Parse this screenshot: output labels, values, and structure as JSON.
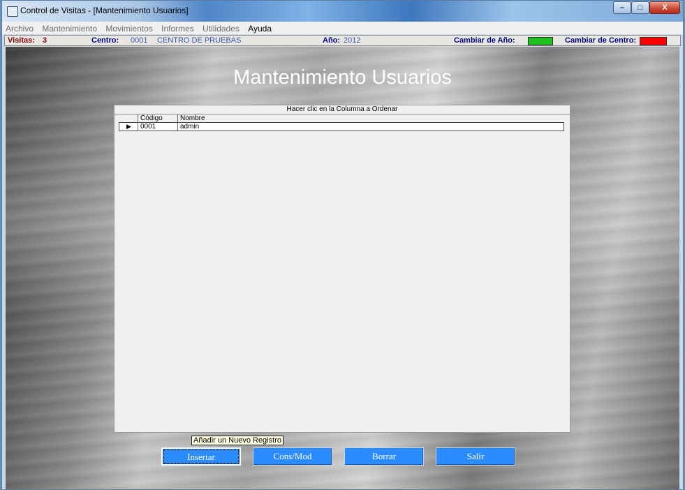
{
  "window": {
    "title": "Control de Visitas - [Mantenimiento Usuarios]",
    "buttons": {
      "minimize": "–",
      "maximize": "□",
      "close": "X"
    }
  },
  "menu": [
    "Archivo",
    "Mantenimiento",
    "Movimientos",
    "Informes",
    "Utilidades",
    "Ayuda"
  ],
  "status": {
    "visitas_label": "Visitas:",
    "visitas_value": "3",
    "centro_label": "Centro:",
    "centro_code": "0001",
    "centro_name": "CENTRO DE PRUEBAS",
    "anio_label": "Año:",
    "anio_value": "2012",
    "cambiar_anio_label": "Cambiar de Año:",
    "cambiar_anio_color": "#1fc11f",
    "cambiar_centro_label": "Cambiar de Centro:",
    "cambiar_centro_color": "#ff0000"
  },
  "page": {
    "heading": "Mantenimiento Usuarios"
  },
  "grid": {
    "caption": "Hacer clic en la Columna a Ordenar",
    "columns": [
      "Código",
      "Nombre"
    ],
    "rows": [
      {
        "codigo": "0001",
        "nombre": "admin"
      }
    ]
  },
  "actions": {
    "insertar": "Insertar",
    "consmod": "Cons/Mod",
    "borrar": "Borrar",
    "salir": "Salir"
  },
  "tooltip": "Añadir un Nuevo Registro"
}
